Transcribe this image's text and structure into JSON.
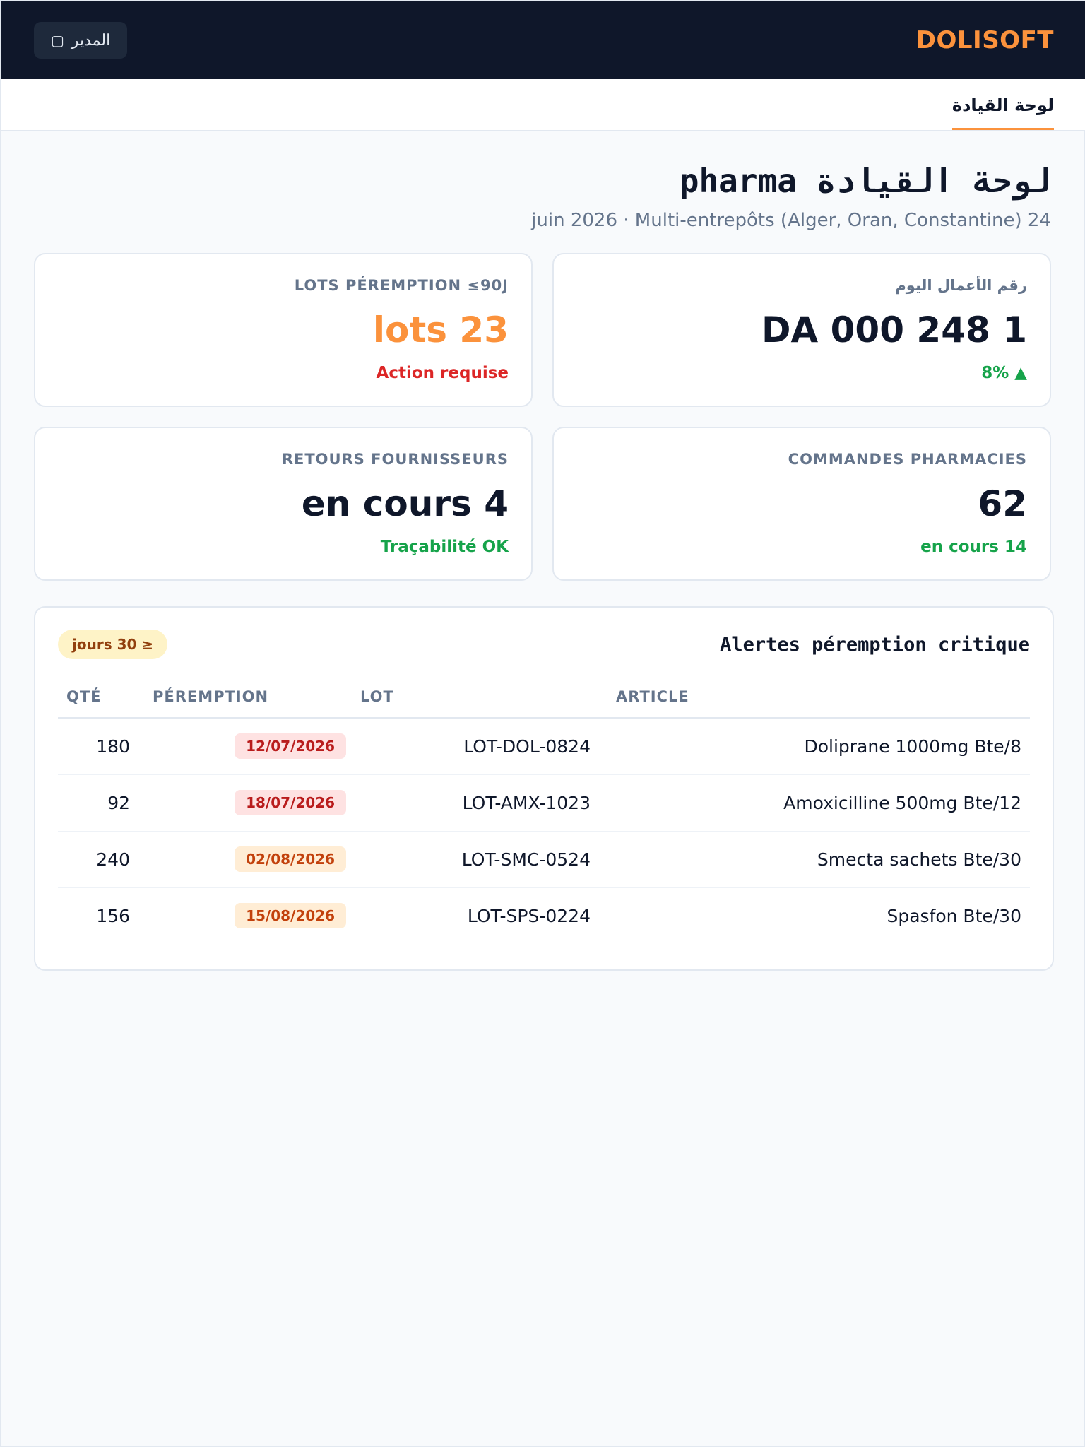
{
  "topbar": {
    "brand": "DOLISOFT",
    "user_label": "المدير",
    "user_icon": "user-icon"
  },
  "tabs": [
    {
      "label": "لوحة القيادة",
      "active": true
    }
  ],
  "header": {
    "title": "لوحة القيادة pharma",
    "subtitle": "24 juin 2026 · Multi-entrepôts (Alger, Oran, Constantine)"
  },
  "kpis": {
    "revenue": {
      "label": "رقم الأعمال اليوم",
      "value": "1 248 000 DA",
      "note": "▲ 8%"
    },
    "expiry_lots": {
      "label": "LOTS PÉREMPTION ≤90J",
      "value": "23 lots",
      "note": "Action requise"
    },
    "pharmacy_orders": {
      "label": "COMMANDES PHARMACIES",
      "value": "62",
      "note": "14 en cours"
    },
    "supplier_returns": {
      "label": "RETOURS FOURNISSEURS",
      "value": "4 en cours",
      "note": "Traçabilité OK"
    }
  },
  "alerts": {
    "title": "Alertes péremption critique",
    "badge": "≤ 30 jours",
    "columns": {
      "qty": "QTÉ",
      "expiry": "PÉREMPTION",
      "lot": "LOT",
      "article": "ARTICLE"
    },
    "rows": [
      {
        "article": "Doliprane 1000mg Bte/8",
        "lot": "LOT-DOL-0824",
        "expiry": "12/07/2026",
        "qty": "180",
        "severity": "red"
      },
      {
        "article": "Amoxicilline 500mg Bte/12",
        "lot": "LOT-AMX-1023",
        "expiry": "18/07/2026",
        "qty": "92",
        "severity": "red"
      },
      {
        "article": "Smecta sachets Bte/30",
        "lot": "LOT-SMC-0524",
        "expiry": "02/08/2026",
        "qty": "240",
        "severity": "orange"
      },
      {
        "article": "Spasfon Bte/30",
        "lot": "LOT-SPS-0224",
        "expiry": "15/08/2026",
        "qty": "156",
        "severity": "orange"
      }
    ]
  },
  "colors": {
    "brand": "#fb923c",
    "topbar": "#0f172a",
    "positive": "#16a34a",
    "negative": "#dc2626"
  }
}
